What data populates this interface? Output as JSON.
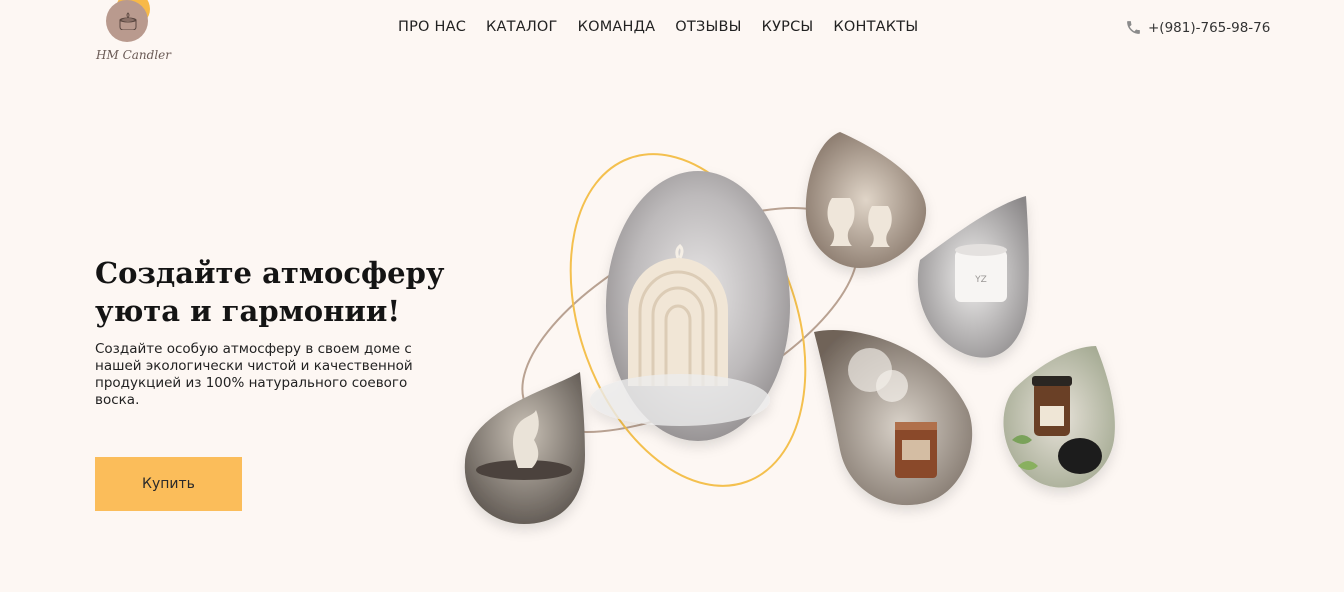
{
  "brand": {
    "logo_text": "HM Candler"
  },
  "nav": [
    {
      "label": "ПРО НАС"
    },
    {
      "label": "КАТАЛОГ"
    },
    {
      "label": "КОМАНДА"
    },
    {
      "label": "ОТЗЫВЫ"
    },
    {
      "label": "КУРСЫ"
    },
    {
      "label": "КОНТАКТЫ"
    }
  ],
  "contact": {
    "phone": "+(981)-765-98-76",
    "icon": "phone-icon"
  },
  "hero": {
    "title": "Создайте атмосферу уюта и гармонии!",
    "subtitle": "Создайте особую атмосферу в своем доме с нашей экологически чистой и качественной продукцией из 100% натурального соевого воска.",
    "button": "Купить"
  },
  "colors": {
    "accent": "#fbbd5a",
    "background": "#fdf7f3",
    "orbit_gold": "#f4c04e",
    "orbit_taupe": "#b9a292"
  },
  "gallery": [
    {
      "icon": "body-candle-photo"
    },
    {
      "icon": "arch-candle-photo"
    },
    {
      "icon": "figure-candles-photo"
    },
    {
      "icon": "jar-candle-photo"
    },
    {
      "icon": "amber-candle-photo"
    },
    {
      "icon": "dark-jar-candle-photo"
    }
  ]
}
